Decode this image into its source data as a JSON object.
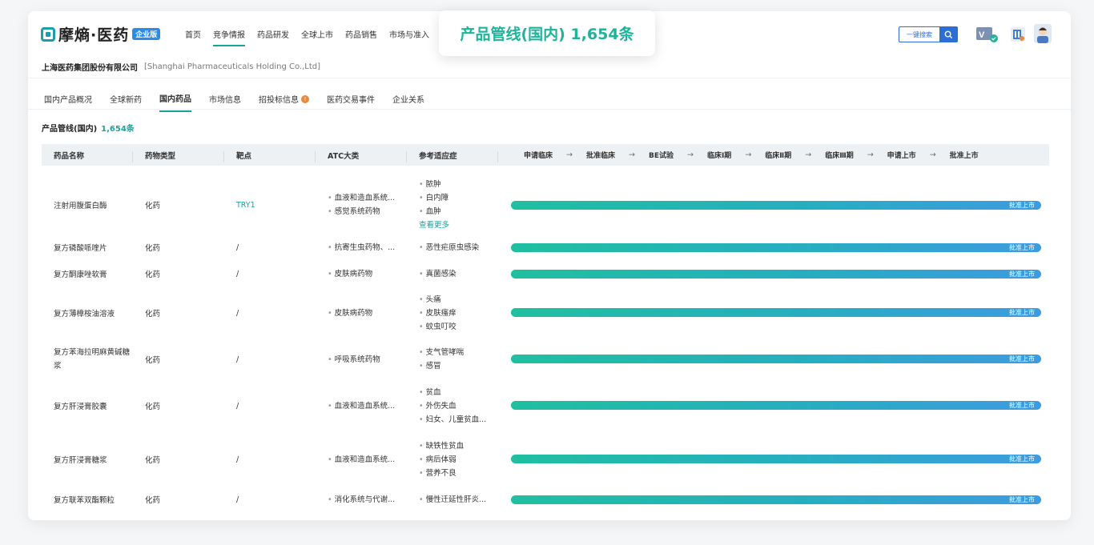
{
  "brand": {
    "name": "摩熵·医药",
    "badge": "企业版"
  },
  "nav": [
    "首页",
    "竞争情报",
    "药品研发",
    "全球上市",
    "药品销售",
    "市场与准入"
  ],
  "search": {
    "label": "一键搜索",
    "icon": "search-icon"
  },
  "company": {
    "name": "上海医药集团股份有限公司",
    "name_en": "[Shanghai Pharmaceuticals Holding Co.,Ltd]"
  },
  "subtabs": [
    "国内产品概况",
    "全球新药",
    "国内药品",
    "市场信息",
    "招投标信息",
    "医药交易事件",
    "企业关系"
  ],
  "section": {
    "title": "产品管线(国内)",
    "count": "1,654条"
  },
  "toast": "产品管线(国内) 1,654条",
  "columns": [
    "药品名称",
    "药物类型",
    "靶点",
    "ATC大类",
    "参考适应症"
  ],
  "stages": [
    "申请临床",
    "批准临床",
    "BE试验",
    "临床Ⅰ期",
    "临床Ⅱ期",
    "临床Ⅲ期",
    "申请上市",
    "批准上市"
  ],
  "colors": {
    "accent": "#1aa39a",
    "bar_start": "#1fbf9f",
    "bar_end": "#3d9be0",
    "link": "#2b6fd6"
  },
  "rows": [
    {
      "name": "注射用腹蛋白酶",
      "type": "化药",
      "target": "TRY1",
      "atc": [
        "血液和造血系统...",
        "感觉系统药物"
      ],
      "indications": [
        "脓肿",
        "白内障",
        "血肿"
      ],
      "more": "查看更多",
      "stage": "批准上市"
    },
    {
      "name": "复方磷酸哌喹片",
      "type": "化药",
      "target": "/",
      "atc": [
        "抗寄生虫药物、..."
      ],
      "indications": [
        "恶性疟原虫感染"
      ],
      "stage": "批准上市"
    },
    {
      "name": "复方酮康唑软膏",
      "type": "化药",
      "target": "/",
      "atc": [
        "皮肤病药物"
      ],
      "indications": [
        "真菌感染"
      ],
      "stage": "批准上市"
    },
    {
      "name": "复方薄樟桉油溶液",
      "type": "化药",
      "target": "/",
      "atc": [
        "皮肤病药物"
      ],
      "indications": [
        "头痛",
        "皮肤瘙痒",
        "蚊虫叮咬"
      ],
      "stage": "批准上市"
    },
    {
      "name": "复方苯海拉明麻黄碱糖浆",
      "type": "化药",
      "target": "/",
      "atc": [
        "呼吸系统药物"
      ],
      "indications": [
        "支气管哮喘",
        "感冒"
      ],
      "stage": "批准上市"
    },
    {
      "name": "复方肝浸膏胶囊",
      "type": "化药",
      "target": "/",
      "atc": [
        "血液和造血系统..."
      ],
      "indications": [
        "贫血",
        "外伤失血",
        "妇女、儿童贫血..."
      ],
      "stage": "批准上市"
    },
    {
      "name": "复方肝浸膏糖浆",
      "type": "化药",
      "target": "/",
      "atc": [
        "血液和造血系统..."
      ],
      "indications": [
        "缺铁性贫血",
        "病后体弱",
        "营养不良"
      ],
      "stage": "批准上市"
    },
    {
      "name": "复方联苯双酯颗粒",
      "type": "化药",
      "target": "/",
      "atc": [
        "消化系统与代谢..."
      ],
      "indications": [
        "慢性迁延性肝炎..."
      ],
      "stage": "批准上市"
    }
  ]
}
